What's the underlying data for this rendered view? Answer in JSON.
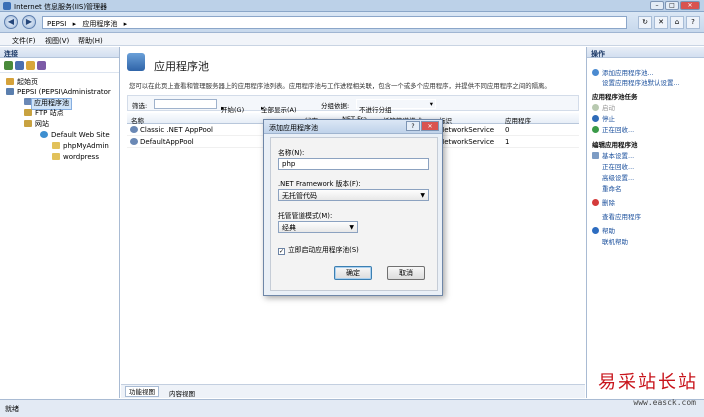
{
  "window": {
    "title": "Internet 信息服务(IIS)管理器"
  },
  "address": {
    "path": [
      "PEPSI",
      "▸",
      "应用程序池",
      "▸"
    ]
  },
  "menu": [
    "文件(F)",
    "视图(V)",
    "帮助(H)"
  ],
  "connections": {
    "title": "连接",
    "tree": [
      {
        "label": "起始页"
      },
      {
        "label": "PEPSI (PEPSI\\Administrator"
      },
      {
        "label": "应用程序池"
      },
      {
        "label": "FTP 站点"
      },
      {
        "label": "网站"
      },
      {
        "label": "Default Web Site"
      },
      {
        "label": "phpMyAdmin"
      },
      {
        "label": "wordpress"
      }
    ]
  },
  "main": {
    "title": "应用程序池",
    "description": "您可以在此页上查看和管理服务器上的应用程序池列表。应用程序池与工作进程相关联，包含一个或多个应用程序，并提供不同应用程序之间的隔离。",
    "filter": {
      "label": "筛选:",
      "start": "开始(G)",
      "show_all": "全部显示(A)",
      "group_by": "分组依据:",
      "group_value": "不进行分组"
    },
    "columns": [
      "名称",
      "状态",
      ".NET Fra...",
      "托管管道模式",
      "标识",
      "应用程序"
    ],
    "rows": [
      {
        "name": "Classic .NET AppPool",
        "identity": "NetworkService",
        "apps": "0"
      },
      {
        "name": "DefaultAppPool",
        "identity": "NetworkService",
        "apps": "1"
      }
    ],
    "tabs": [
      "功能视图",
      "内容视图"
    ]
  },
  "actions": {
    "title": "操作",
    "items": [
      "添加应用程序池...",
      "设置应用程序池默认设置...",
      "应用程序池任务",
      "启动",
      "停止",
      "正在回收...",
      "编辑应用程序池",
      "基本设置...",
      "正在回收...",
      "高级设置...",
      "重命名",
      "删除",
      "查看应用程序",
      "帮助",
      "联机帮助"
    ]
  },
  "dialog": {
    "title": "添加应用程序池",
    "name_label": "名称(N):",
    "name_value": "php",
    "framework_label": ".NET Framework 版本(F):",
    "framework_value": "无托管代码",
    "pipeline_label": "托管管道模式(M):",
    "pipeline_value": "经典",
    "autostart_label": "立即启动应用程序池(S)",
    "ok": "确定",
    "cancel": "取消"
  },
  "status": {
    "text": "就绪"
  },
  "watermark": {
    "text": "易采站长站",
    "url": "www.easck.com"
  }
}
